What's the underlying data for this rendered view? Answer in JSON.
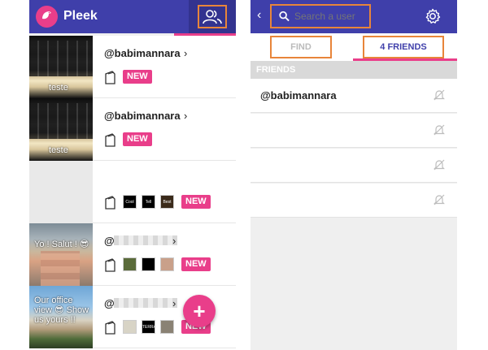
{
  "left_app": {
    "title": "Pleek",
    "feed": [
      {
        "thumb_caption": "teste",
        "username": "@babimannara",
        "badge": "NEW",
        "masked": false
      },
      {
        "thumb_caption": "teste",
        "username": "@babimannara",
        "badge": "NEW",
        "masked": false
      },
      {
        "thumb_caption": "",
        "username": "",
        "badge": "NEW",
        "masked": false,
        "minis": [
          "Cool",
          "Tell me about... A friend",
          "Best of Pleek"
        ]
      },
      {
        "thumb_caption": "Yo ! Salut ! 😎",
        "username": "@",
        "badge": "NEW",
        "masked": true
      },
      {
        "thumb_caption": "Our office view 😎 Show us yours !!",
        "username": "@",
        "badge": "NEW",
        "masked": true,
        "minis": [
          "",
          "",
          "TERRA",
          ""
        ]
      }
    ],
    "fab_label": "+"
  },
  "right_app": {
    "search": {
      "placeholder": "Search a user"
    },
    "tabs": {
      "find": "FIND",
      "friends": "4 FRIENDS"
    },
    "section_label": "FRIENDS",
    "friends": [
      "@babimannara",
      "",
      "",
      ""
    ]
  },
  "colors": {
    "header": "#3f3faa",
    "accent": "#e93e8a",
    "highlight": "#e8853a"
  }
}
